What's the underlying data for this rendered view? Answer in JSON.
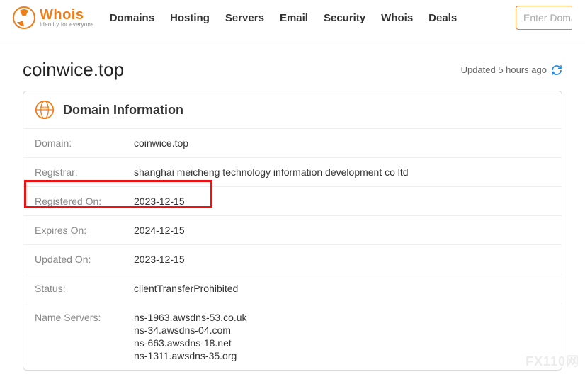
{
  "logo": {
    "main": "Whois",
    "sub": "Identity for everyone"
  },
  "nav": {
    "n0": "Domains",
    "n1": "Hosting",
    "n2": "Servers",
    "n3": "Email",
    "n4": "Security",
    "n5": "Whois",
    "n6": "Deals"
  },
  "search": {
    "placeholder": "Enter Domain"
  },
  "page": {
    "domain_title": "coinwice.top",
    "updated_text": "Updated 5 hours ago"
  },
  "card": {
    "title": "Domain Information",
    "labels": {
      "domain": "Domain:",
      "registrar": "Registrar:",
      "registered_on": "Registered On:",
      "expires_on": "Expires On:",
      "updated_on": "Updated On:",
      "status": "Status:",
      "name_servers": "Name Servers:"
    },
    "values": {
      "domain": "coinwice.top",
      "registrar": "shanghai meicheng technology information development co ltd",
      "registered_on": "2023-12-15",
      "expires_on": "2024-12-15",
      "updated_on": "2023-12-15",
      "status": "clientTransferProhibited",
      "ns0": "ns-1963.awsdns-53.co.uk",
      "ns1": "ns-34.awsdns-04.com",
      "ns2": "ns-663.awsdns-18.net",
      "ns3": "ns-1311.awsdns-35.org"
    }
  },
  "watermark": "FX110网"
}
